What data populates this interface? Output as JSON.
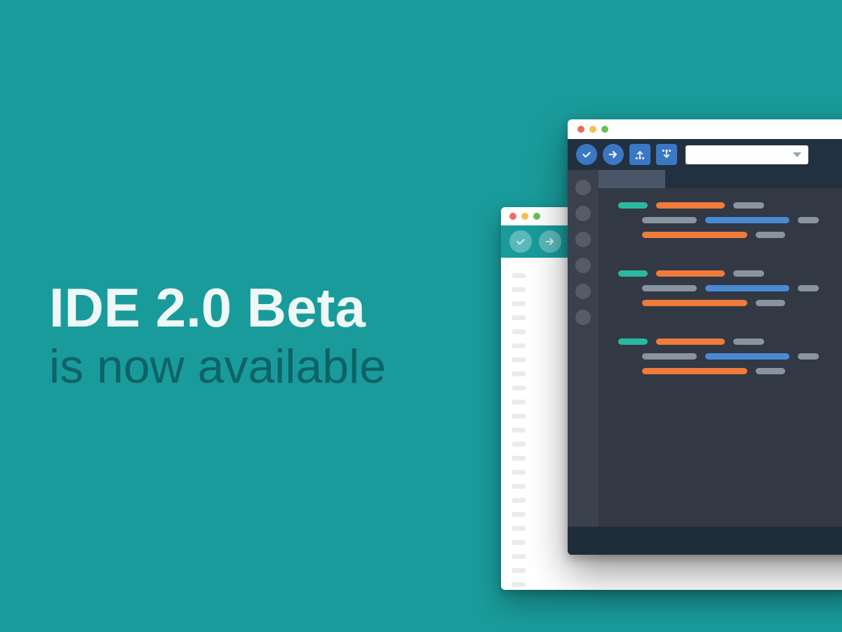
{
  "headline": {
    "line1": "IDE 2.0 Beta",
    "line2": "is now available"
  },
  "colors": {
    "background": "#1a9b9b",
    "headline_primary": "#eef8f7",
    "headline_secondary": "#0d6366",
    "new_window_bg": "#323844",
    "new_toolbar_bg": "#22313f",
    "accent_blue": "#3b78c4",
    "old_toolbar_bg": "#1a9b9b",
    "code_teal": "#2bb8a3",
    "code_orange": "#ee7b3a",
    "code_grey": "#8a93a0",
    "code_blue": "#4a8ad4"
  },
  "old_ide": {
    "toolbar_icons": [
      "check",
      "arrow-right"
    ]
  },
  "new_ide": {
    "toolbar_icons_round": [
      "check",
      "arrow-right"
    ],
    "toolbar_icons_square": [
      "download",
      "download"
    ],
    "board_dropdown_value": "",
    "sidebar_icon_count": 6
  }
}
